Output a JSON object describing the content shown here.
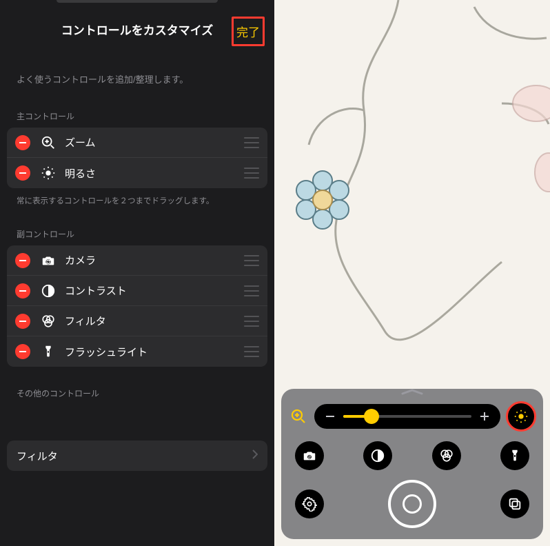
{
  "header": {
    "title": "コントロールをカスタマイズ",
    "done": "完了"
  },
  "hints": {
    "intro": "よく使うコントロールを追加/整理します。",
    "main_section": "主コントロール",
    "main_drag_hint": "常に表示するコントロールを２つまでドラッグします。",
    "sub_section": "副コントロール",
    "other_section": "その他のコントロール"
  },
  "main_controls": [
    {
      "icon": "zoom-in-icon",
      "label": "ズーム"
    },
    {
      "icon": "brightness-icon",
      "label": "明るさ"
    }
  ],
  "sub_controls": [
    {
      "icon": "camera-switch-icon",
      "label": "カメラ"
    },
    {
      "icon": "contrast-icon",
      "label": "コントラスト"
    },
    {
      "icon": "filters-icon",
      "label": "フィルタ"
    },
    {
      "icon": "flashlight-icon",
      "label": "フラッシュライト"
    }
  ],
  "other_nav": {
    "label": "フィルタ"
  },
  "viewer": {
    "slider": {
      "value_pct": 22
    },
    "circle_icons": [
      "camera-switch-icon",
      "contrast-icon",
      "filters-icon",
      "flashlight-icon"
    ],
    "bottom_icons": [
      "settings-gear-icon",
      "multitask-icon"
    ]
  },
  "colors": {
    "accent": "#ffcc00",
    "highlight_border": "#ff3b30"
  }
}
